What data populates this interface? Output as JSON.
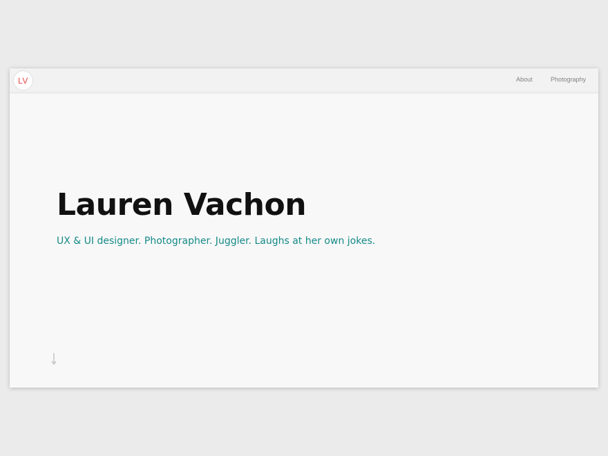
{
  "header": {
    "logo_text": "LV",
    "nav": [
      {
        "label": "About"
      },
      {
        "label": "Photography"
      }
    ]
  },
  "hero": {
    "title": "Lauren Vachon",
    "subtitle": "UX & UI designer. Photographer. Juggler. Laughs at her own jokes."
  },
  "icons": {
    "scroll": "arrow-down-icon"
  },
  "colors": {
    "logo": "#e84545",
    "accent": "#148a87",
    "background": "#f8f8f8",
    "navbar": "#f2f2f2"
  }
}
